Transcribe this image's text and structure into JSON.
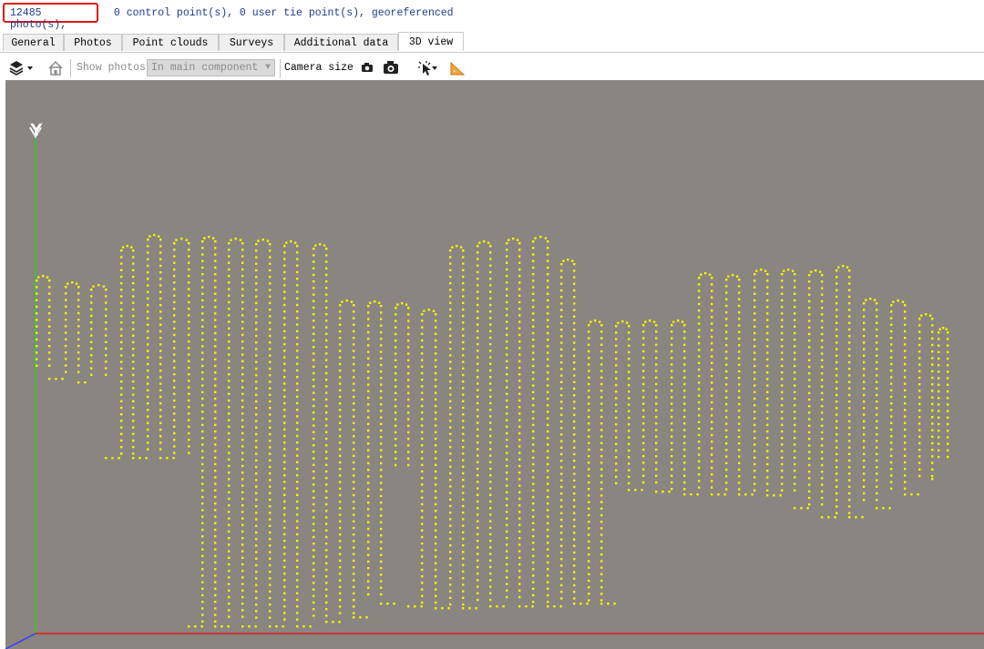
{
  "status": {
    "photos": "12485 photo(s),",
    "rest": " 0 control point(s), 0 user tie point(s), georeferenced"
  },
  "tabs": [
    {
      "label": "General"
    },
    {
      "label": "Photos"
    },
    {
      "label": "Point clouds"
    },
    {
      "label": "Surveys"
    },
    {
      "label": "Additional data"
    },
    {
      "label": "3D view",
      "active": true
    }
  ],
  "toolbar": {
    "show_photos_label": "Show photos",
    "show_photos_selected": "In main component",
    "camera_size_label": "Camera size"
  },
  "view": {
    "y_axis_label": "Y",
    "background_color": "#8b8581",
    "camera_color": "#f4f400",
    "x_axis_color": "#e01b1b",
    "y_axis_color": "#2ecc2e",
    "z_axis_color": "#2a3cff"
  }
}
